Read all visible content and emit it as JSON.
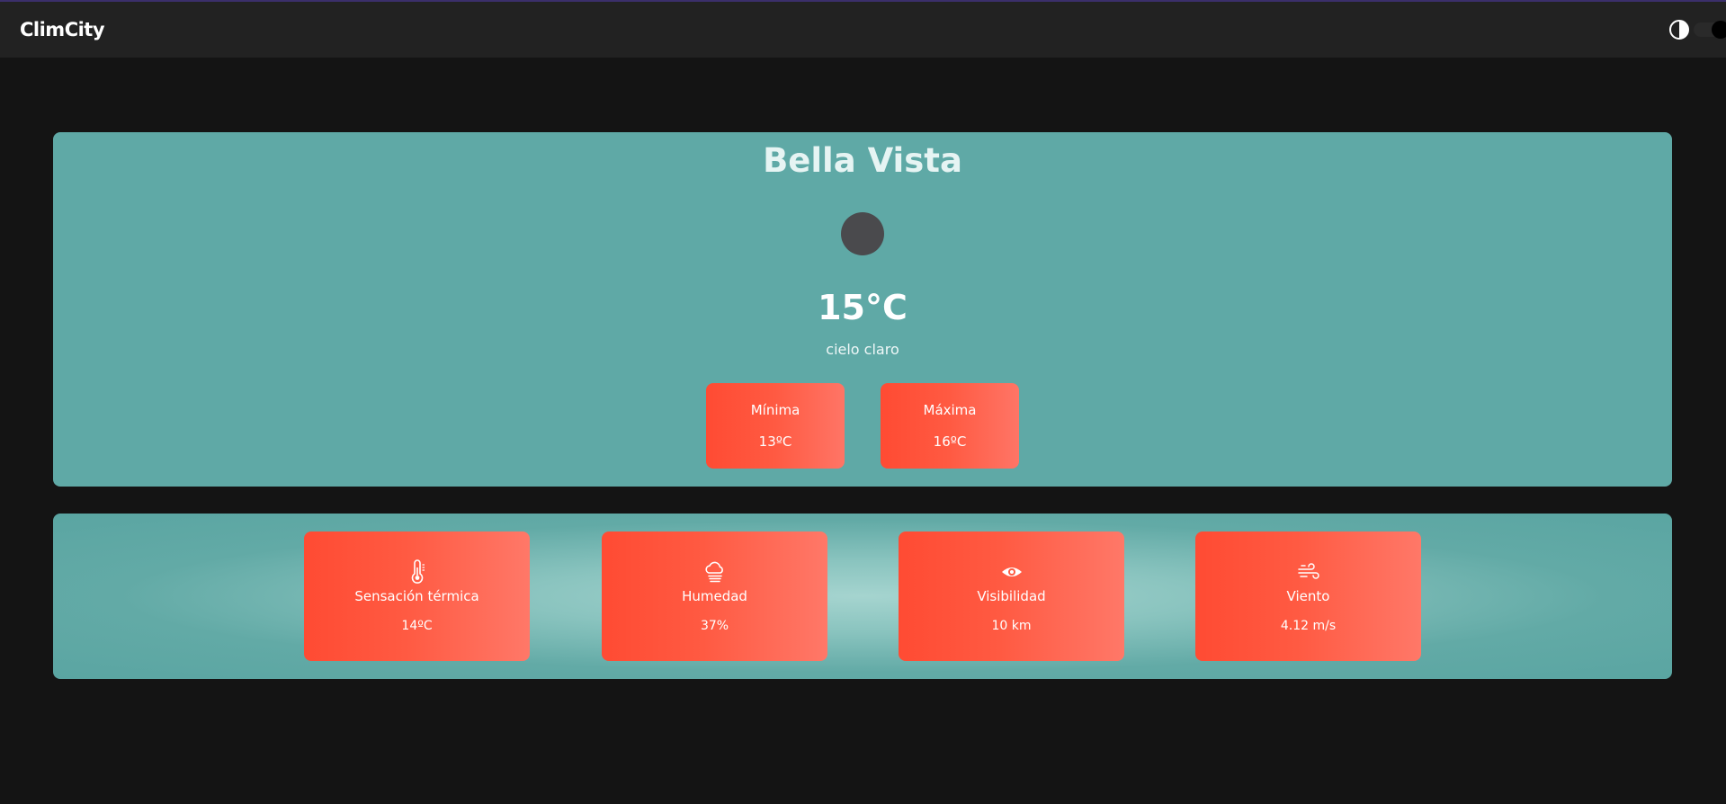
{
  "app": {
    "brand": "ClimCity"
  },
  "theme_toggle": {
    "icon": "contrast-icon",
    "state": "dark"
  },
  "weather": {
    "city": "Bella Vista",
    "icon": "weather-icon-placeholder",
    "temperature": "15°C",
    "description": "cielo claro",
    "min": {
      "label": "Mínima",
      "value": "13ºC"
    },
    "max": {
      "label": "Máxima",
      "value": "16ºC"
    }
  },
  "details": [
    {
      "icon": "thermometer-icon",
      "label": "Sensación térmica",
      "value": "14ºC"
    },
    {
      "icon": "cloud-humidity-icon",
      "label": "Humedad",
      "value": "37%"
    },
    {
      "icon": "eye-icon",
      "label": "Visibilidad",
      "value": "10 km"
    },
    {
      "icon": "wind-icon",
      "label": "Viento",
      "value": "4.12 m/s"
    }
  ],
  "colors": {
    "background": "#141414",
    "navbar": "#222222",
    "card": "#5fa9a6",
    "accent": "#ff4b33"
  }
}
